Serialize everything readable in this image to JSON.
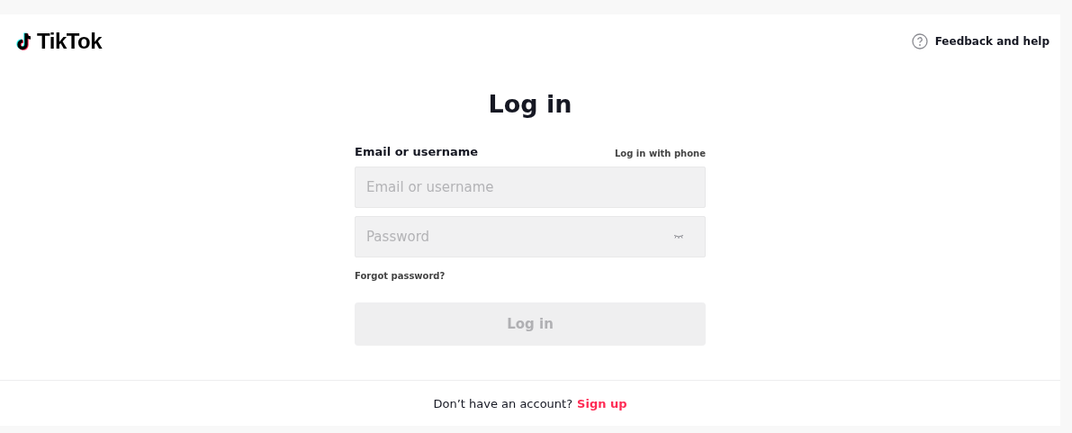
{
  "header": {
    "logo": "TikTok",
    "help_link": "Feedback and help"
  },
  "title": "Log in",
  "form": {
    "label": "Email or username",
    "alt_link": "Log in with phone",
    "fields": [
      {
        "kind": "text",
        "placeholder": "Email or username"
      },
      {
        "kind": "password",
        "placeholder": "Password"
      }
    ],
    "forgot_link": "Forgot password?",
    "submit": {
      "label": "Log in",
      "disabled": true
    }
  },
  "footer": {
    "text": "Don’t have an account?",
    "link": "Sign up"
  }
}
